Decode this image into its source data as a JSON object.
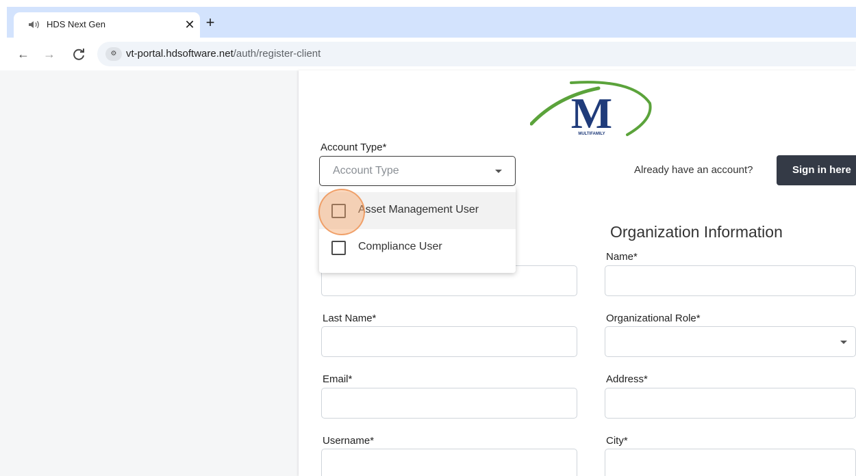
{
  "browser": {
    "tab_title": "HDS Next Gen",
    "tab_close": "✕",
    "new_tab": "+",
    "url_host": "vt-portal.hdsoftware.net",
    "url_path": "/auth/register-client",
    "back": "←",
    "forward": "→",
    "reload": "C"
  },
  "logo": {
    "letter": "M",
    "caption": "MULTIFAMILY",
    "colors": {
      "navy": "#1f3b7a",
      "green": "#5ba33b"
    }
  },
  "form": {
    "account_type": {
      "label": "Account Type*",
      "placeholder": "Account Type",
      "options": [
        {
          "label": "Asset Management User",
          "checked": false,
          "hovered": true
        },
        {
          "label": "Compliance User",
          "checked": false,
          "hovered": false
        }
      ]
    },
    "already_text": "Already have an account?",
    "signin_label": "Sign in here",
    "org_title": "Organization Information",
    "left_fields": [
      {
        "label": "Last Name*"
      },
      {
        "label": "Email*"
      },
      {
        "label": "Username*"
      }
    ],
    "right_fields": [
      {
        "label": "Name*"
      },
      {
        "label": "Organizational Role*"
      },
      {
        "label": "Address*"
      },
      {
        "label": "City*"
      }
    ]
  },
  "colors": {
    "tabstrip": "#d3e3fd",
    "signin_button": "#343a46",
    "click_highlight": "#f6a66a"
  }
}
